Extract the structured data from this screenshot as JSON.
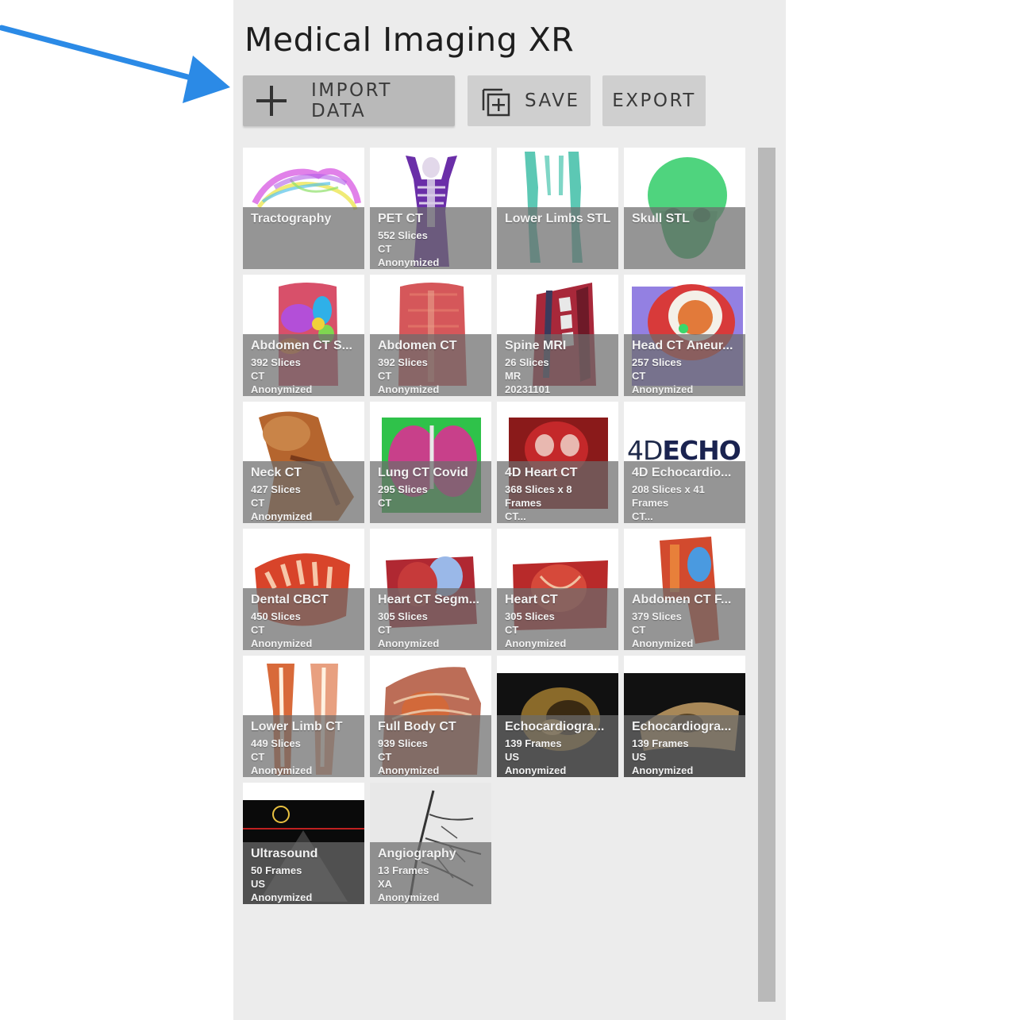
{
  "app": {
    "title": "Medical Imaging XR"
  },
  "toolbar": {
    "import_label": "IMPORT DATA",
    "save_label": "SAVE",
    "export_label": "EXPORT"
  },
  "annotation": {
    "arrow_color": "#2b8ae6"
  },
  "tiles": [
    {
      "title": "Tractography",
      "line1": "",
      "line2": "",
      "line3": ""
    },
    {
      "title": "PET CT",
      "line1": "552 Slices",
      "line2": "CT",
      "line3": "Anonymized"
    },
    {
      "title": "Lower Limbs STL",
      "line1": "",
      "line2": "",
      "line3": ""
    },
    {
      "title": "Skull STL",
      "line1": "",
      "line2": "",
      "line3": ""
    },
    {
      "title": "Abdomen CT S...",
      "line1": "392 Slices",
      "line2": "CT",
      "line3": "Anonymized"
    },
    {
      "title": "Abdomen CT",
      "line1": "392 Slices",
      "line2": "CT",
      "line3": "Anonymized"
    },
    {
      "title": "Spine MRI",
      "line1": "26 Slices",
      "line2": "MR",
      "line3": "20231101"
    },
    {
      "title": "Head CT Aneur...",
      "line1": "257 Slices",
      "line2": "CT",
      "line3": "Anonymized"
    },
    {
      "title": "Neck CT",
      "line1": "427 Slices",
      "line2": "CT",
      "line3": "Anonymized"
    },
    {
      "title": "Lung CT Covid",
      "line1": "",
      "line2": "295 Slices",
      "line3": "CT"
    },
    {
      "title": "4D Heart CT",
      "line1": "368 Slices x 8",
      "line2": "Frames",
      "line3": "CT..."
    },
    {
      "title": "4D Echocardio...",
      "line1": "208 Slices x 41",
      "line2": "Frames",
      "line3": "CT...",
      "logo_a": "4D",
      "logo_b": "ECHO"
    },
    {
      "title": "Dental CBCT",
      "line1": "450 Slices",
      "line2": "CT",
      "line3": "Anonymized"
    },
    {
      "title": "Heart CT Segm...",
      "line1": "305 Slices",
      "line2": "CT",
      "line3": "Anonymized"
    },
    {
      "title": "Heart CT",
      "line1": "305 Slices",
      "line2": "CT",
      "line3": "Anonymized"
    },
    {
      "title": "Abdomen CT F...",
      "line1": "379 Slices",
      "line2": "CT",
      "line3": "Anonymized"
    },
    {
      "title": "Lower Limb CT",
      "line1": "449 Slices",
      "line2": "CT",
      "line3": "Anonymized"
    },
    {
      "title": "Full Body CT",
      "line1": "939 Slices",
      "line2": "CT",
      "line3": "Anonymized"
    },
    {
      "title": "Echocardiogra...",
      "line1": "139 Frames",
      "line2": "US",
      "line3": "Anonymized"
    },
    {
      "title": "Echocardiogra...",
      "line1": "139 Frames",
      "line2": "US",
      "line3": "Anonymized"
    },
    {
      "title": "Ultrasound",
      "line1": "50 Frames",
      "line2": "US",
      "line3": "Anonymized"
    },
    {
      "title": "Angiography",
      "line1": "13 Frames",
      "line2": "XA",
      "line3": "Anonymized"
    }
  ]
}
